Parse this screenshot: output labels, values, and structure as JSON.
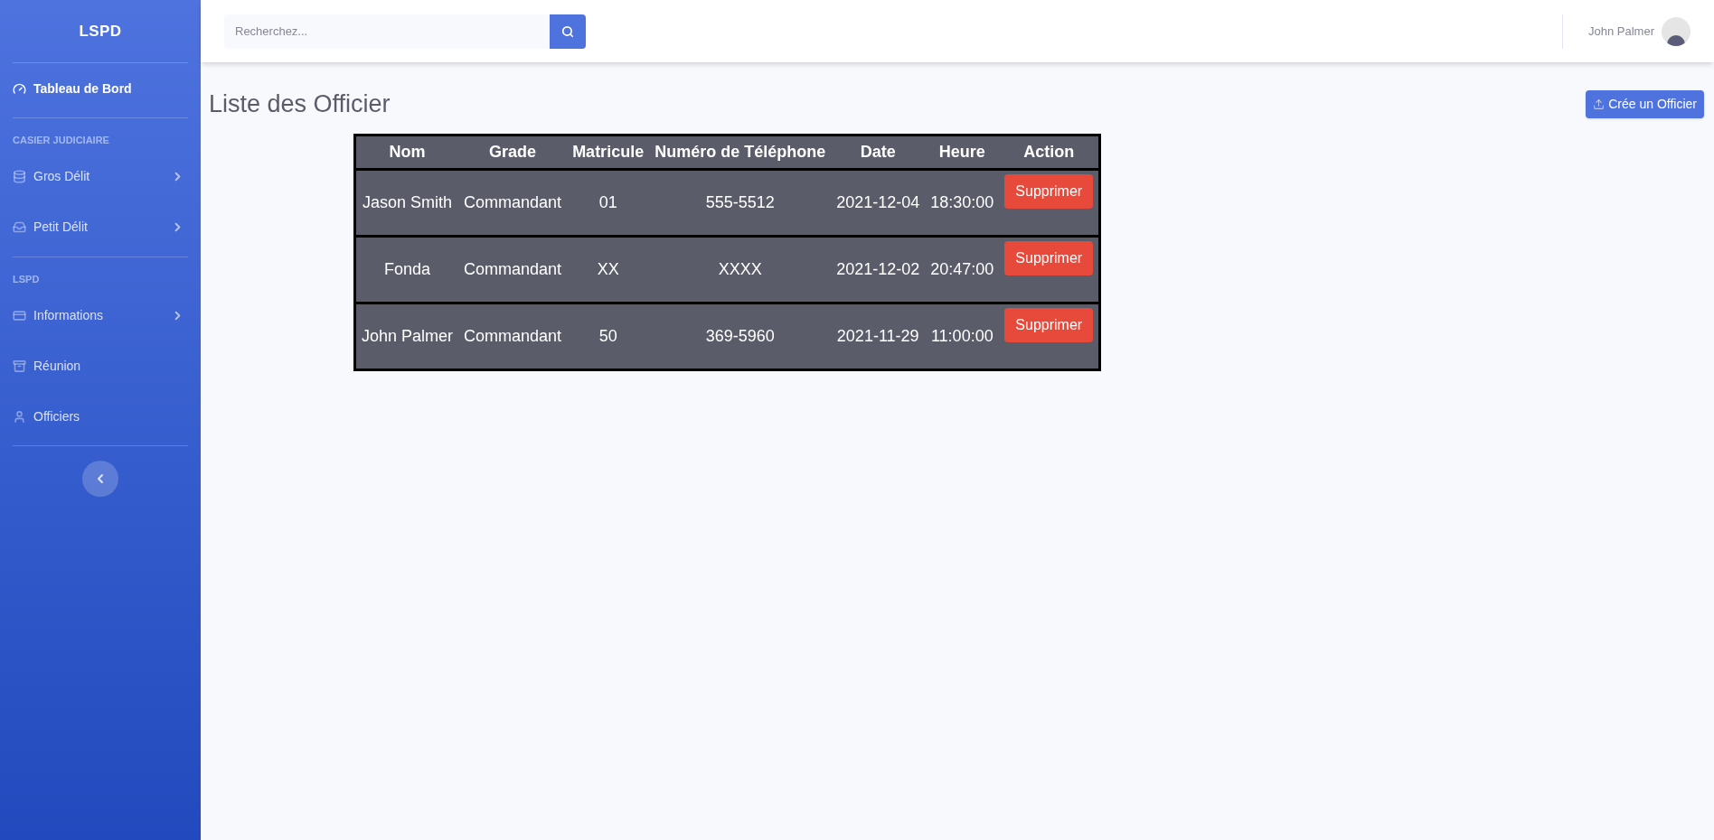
{
  "sidebar": {
    "brand": "LSPD",
    "sections": [
      {
        "items": [
          {
            "label": "Tableau de Bord",
            "selected": true,
            "expandable": false
          }
        ]
      },
      {
        "heading": "CASIER JUDICIAIRE",
        "items": [
          {
            "label": "Gros Délit",
            "selected": false,
            "expandable": true
          },
          {
            "label": "Petit Délit",
            "selected": false,
            "expandable": true
          }
        ]
      },
      {
        "heading": "LSPD",
        "items": [
          {
            "label": "Informations",
            "selected": false,
            "expandable": true
          },
          {
            "label": "Réunion",
            "selected": false,
            "expandable": false
          },
          {
            "label": "Officiers",
            "selected": false,
            "expandable": false
          }
        ]
      }
    ]
  },
  "topbar": {
    "search": {
      "placeholder": "Recherchez..."
    },
    "user": {
      "name": "John Palmer"
    }
  },
  "page": {
    "title": "Liste des Officier",
    "create_button": "Crée un Officier"
  },
  "table": {
    "columns": [
      "Nom",
      "Grade",
      "Matricule",
      "Numéro de Téléphone",
      "Date",
      "Heure",
      "Action"
    ],
    "rows": [
      {
        "cells": [
          "Jason Smith",
          "Commandant",
          "01",
          "555-5512",
          "2021-12-04",
          "18:30:00"
        ],
        "action": "Supprimer"
      },
      {
        "cells": [
          "Fonda",
          "Commandant",
          "XX",
          "XXXX",
          "2021-12-02",
          "20:47:00"
        ],
        "action": "Supprimer"
      },
      {
        "cells": [
          "John Palmer",
          "Commandant",
          "50",
          "369-5960",
          "2021-11-29",
          "11:00:00"
        ],
        "action": "Supprimer"
      }
    ]
  }
}
